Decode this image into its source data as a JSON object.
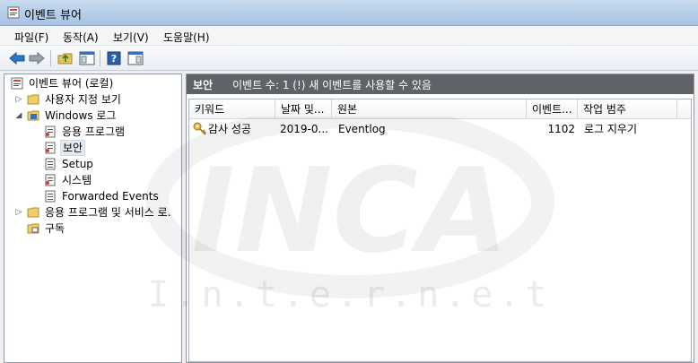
{
  "window": {
    "title": "이벤트 뷰어"
  },
  "menu": [
    "파일(F)",
    "동작(A)",
    "보기(V)",
    "도움말(H)"
  ],
  "tree": {
    "root": "이벤트 뷰어 (로컬)",
    "custom_views": "사용자 지정 보기",
    "windows_logs": "Windows 로그",
    "app": "응용 프로그램",
    "security": "보안",
    "setup": "Setup",
    "system": "시스템",
    "forwarded": "Forwarded Events",
    "apps_services": "응용 프로그램 및 서비스 로.",
    "subscriptions": "구독"
  },
  "panel": {
    "title": "보안",
    "info": "이벤트 수: 1 (!) 새 이벤트를 사용할 수 있음"
  },
  "columns": [
    "키워드",
    "날짜 및...",
    "원본",
    "이벤트...",
    "작업 범주"
  ],
  "rows": [
    {
      "keyword": "감사 성공",
      "date": "2019-0...",
      "source": "Eventlog",
      "event_id": "1102",
      "category": "로그 지우기"
    }
  ],
  "watermark": {
    "brand": "INCA",
    "sub": "I.n.t.e.r.n.e.t"
  }
}
